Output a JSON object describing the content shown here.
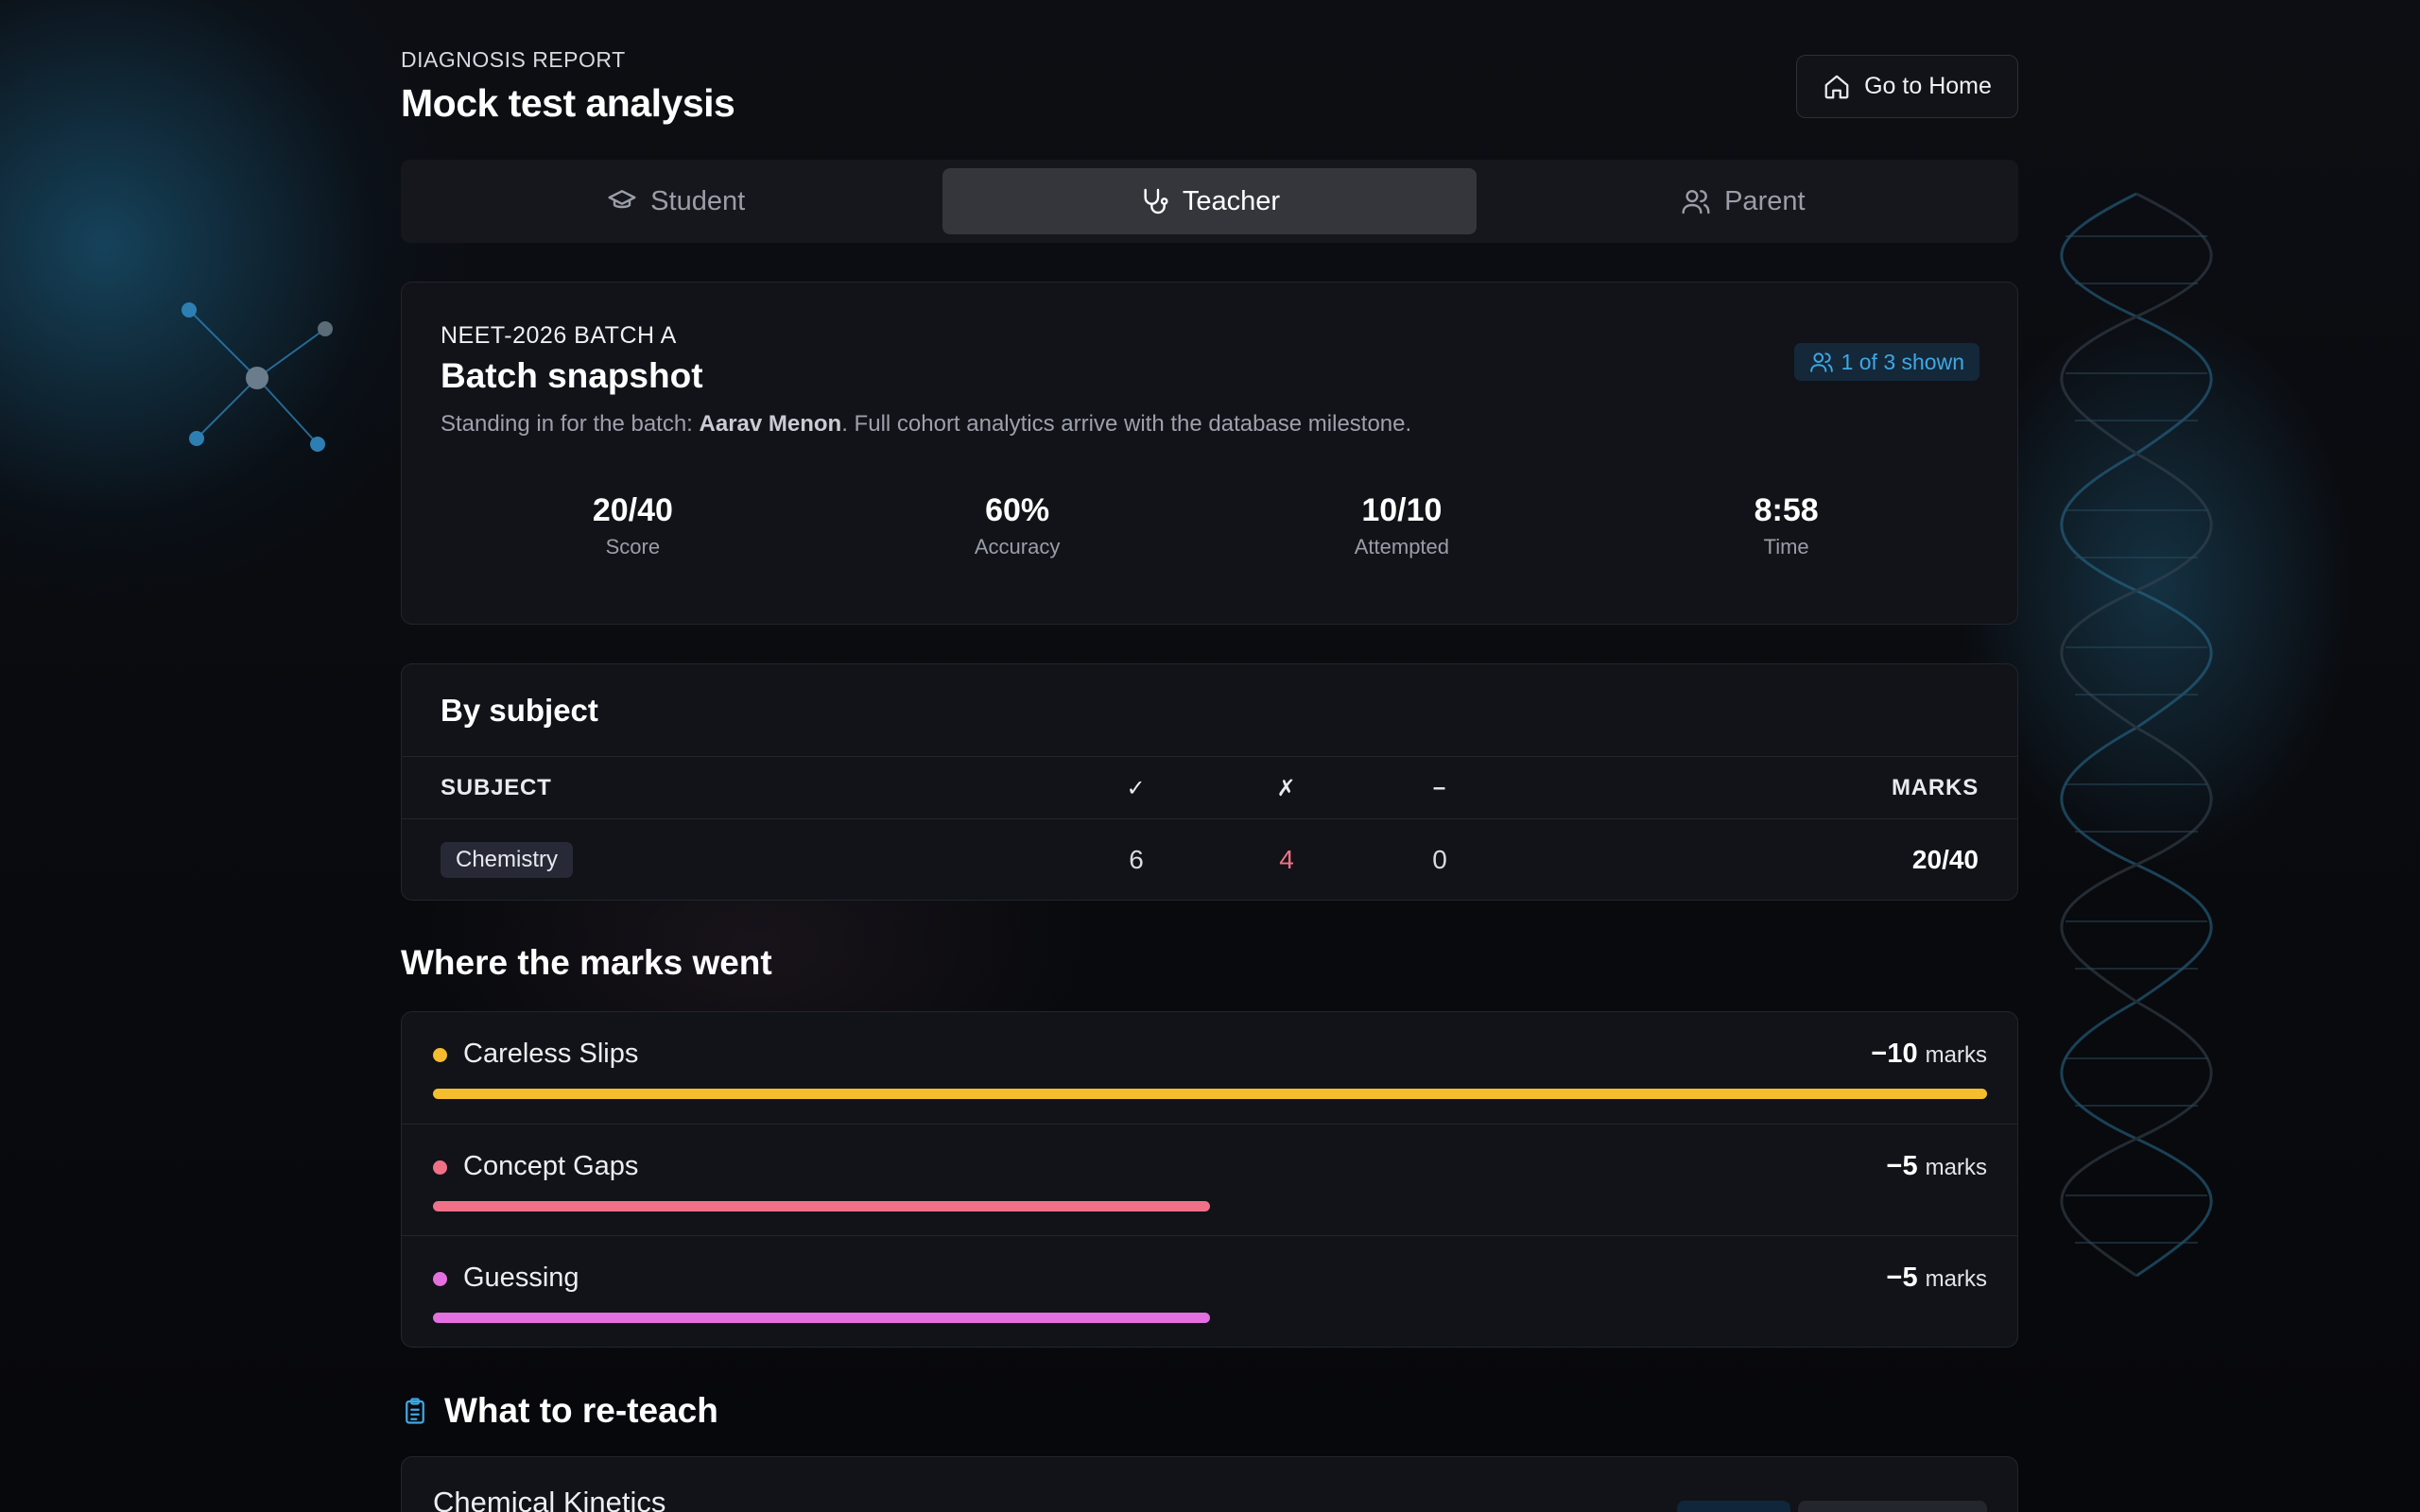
{
  "header": {
    "eyebrow": "DIAGNOSIS REPORT",
    "title": "Mock test analysis",
    "home_button": "Go to Home"
  },
  "tabs": [
    {
      "label": "Student",
      "icon": "graduation-cap-icon",
      "active": false
    },
    {
      "label": "Teacher",
      "icon": "stethoscope-icon",
      "active": true
    },
    {
      "label": "Parent",
      "icon": "users-icon",
      "active": false
    }
  ],
  "snapshot": {
    "batch": "NEET-2026 BATCH A",
    "title": "Batch snapshot",
    "desc_prefix": "Standing in for the batch: ",
    "student": "Aarav Menon",
    "desc_suffix": ". Full cohort analytics arrive with the database milestone.",
    "badge": "1 of 3 shown",
    "stats": [
      {
        "value": "20/40",
        "label": "Score"
      },
      {
        "value": "60%",
        "label": "Accuracy"
      },
      {
        "value": "10/10",
        "label": "Attempted"
      },
      {
        "value": "8:58",
        "label": "Time"
      }
    ]
  },
  "by_subject": {
    "title": "By subject",
    "headers": {
      "subject": "SUBJECT",
      "correct": "✓",
      "wrong": "✗",
      "skipped": "–",
      "marks": "MARKS"
    },
    "rows": [
      {
        "subject": "Chemistry",
        "correct": "6",
        "wrong": "4",
        "skipped": "0",
        "marks": "20/40"
      }
    ]
  },
  "marks_lost": {
    "title": "Where the marks went",
    "unit": "marks",
    "items": [
      {
        "name": "Careless Slips",
        "amount": "−10",
        "value": 10,
        "color": "#f5bd2e"
      },
      {
        "name": "Concept Gaps",
        "amount": "−5",
        "value": 5,
        "color": "#f07187"
      },
      {
        "name": "Guessing",
        "amount": "−5",
        "value": 5,
        "color": "#e46fe0"
      }
    ]
  },
  "reteach": {
    "title": "What to re-teach",
    "items": [
      {
        "name": "Chemical Kinetics"
      }
    ]
  },
  "colors": {
    "accent": "#3fa8e4",
    "wrong": "#f07187"
  }
}
